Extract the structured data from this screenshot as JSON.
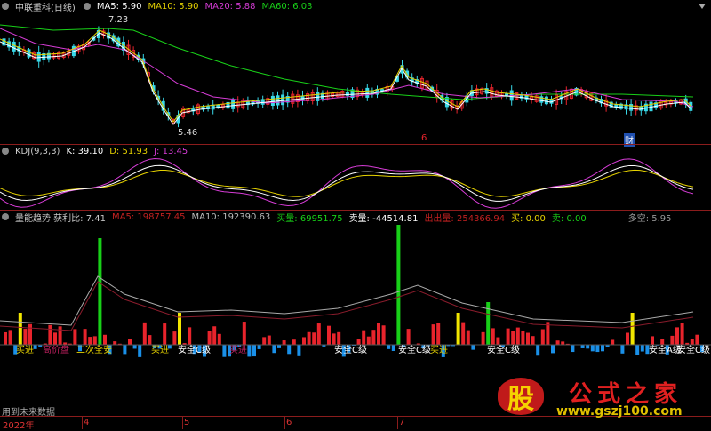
{
  "main": {
    "name": "中联重科(日线)",
    "ma5": "MA5: 5.90",
    "ma10": "MA10: 5.90",
    "ma20": "MA20: 5.88",
    "ma60": "MA60: 6.03",
    "high_label": "7.23",
    "low_label": "5.46",
    "markers": [
      "6",
      "财"
    ],
    "colors": {
      "ma5": "#ffffff",
      "ma10": "#e6d200",
      "ma20": "#d63cd6",
      "ma60": "#18d018",
      "up": "#e8242c",
      "down": "#38d8e8"
    }
  },
  "kdj": {
    "name": "KDJ(9,3,3)",
    "k": "K: 39.10",
    "d": "D: 51.93",
    "j": "J: 13.45"
  },
  "vol": {
    "name": "量能趋势 获利比: 7.41",
    "ma5": "MA5: 198757.45",
    "ma10": "MA10: 192390.63",
    "buy": "买量: 69951.75",
    "sell": "卖量: -44514.81",
    "out": "出出量: 254366.94",
    "b": "买: 0.00",
    "s": "卖: 0.00",
    "dk": "多空: 5.95",
    "signals": [
      "买进",
      "高价盘",
      "二次全安",
      "买进",
      "安全C级",
      "买进",
      "安全C级",
      "安全C级",
      "买进",
      "安全C级",
      "安全A级",
      "安全C级"
    ]
  },
  "footer": {
    "note": "用到未来数据",
    "timeline": [
      "2022年",
      "4",
      "5",
      "6",
      "7"
    ]
  },
  "watermark": {
    "glyph": "股",
    "title": "公式之家",
    "url": "www.gszj100.com"
  }
}
